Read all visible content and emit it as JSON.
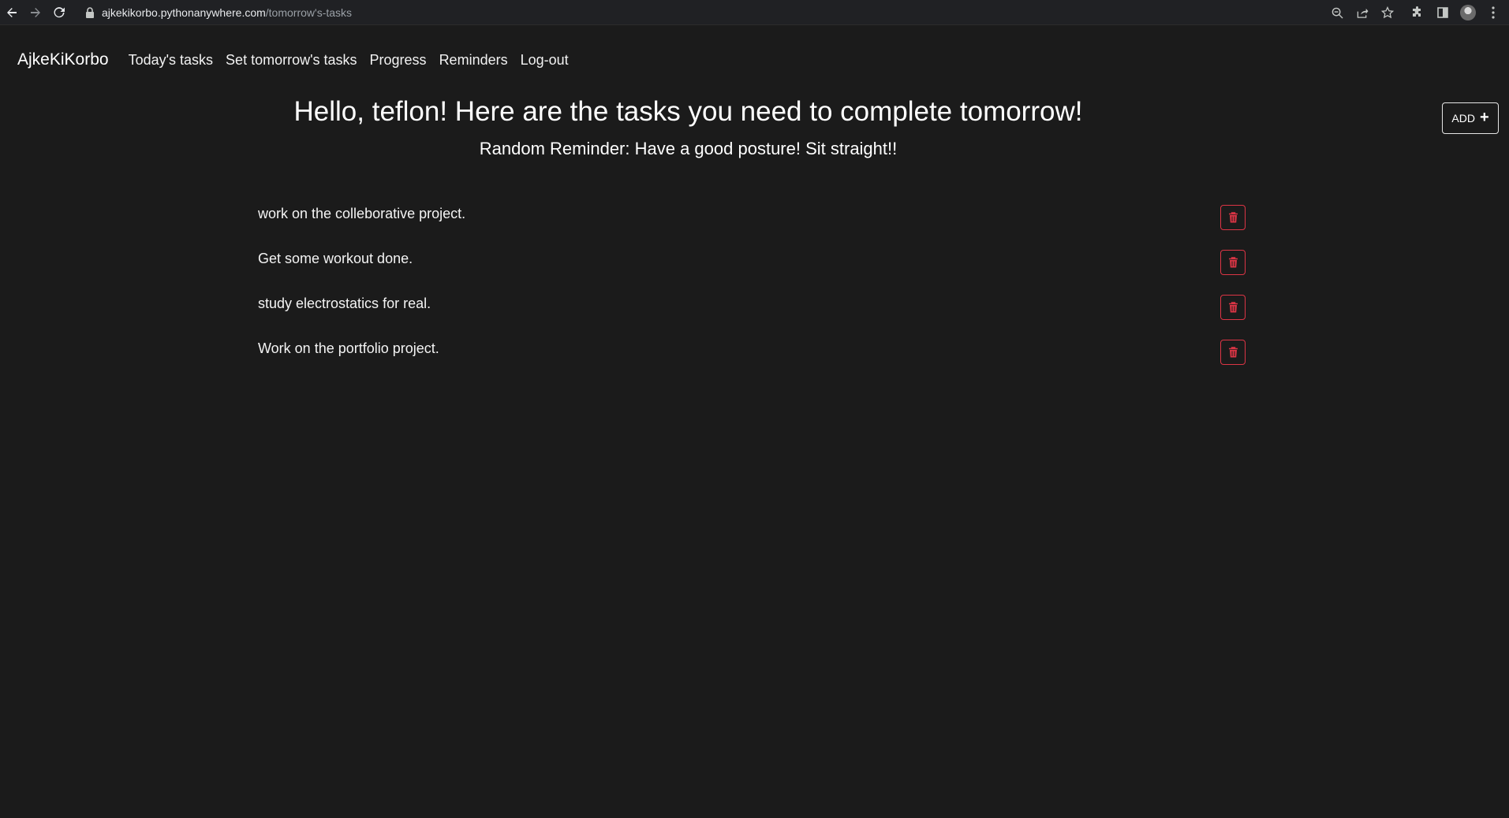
{
  "browser": {
    "url_host": "ajkekikorbo.pythonanywhere.com",
    "url_path": "/tomorrow's-tasks"
  },
  "nav": {
    "brand": "AjkeKiKorbo",
    "links": [
      "Today's tasks",
      "Set tomorrow's tasks",
      "Progress",
      "Reminders",
      "Log-out"
    ]
  },
  "main": {
    "heading": "Hello, teflon! Here are the tasks you need to complete tomorrow!",
    "reminder": "Random Reminder: Have a good posture! Sit straight!!",
    "add_label": "ADD",
    "tasks": [
      "work on the colleborative project.",
      "Get some workout done.",
      "study electrostatics for real.",
      "Work on the portfolio project."
    ]
  },
  "colors": {
    "background": "#1b1b1b",
    "danger": "#dc3545",
    "text": "#ffffff"
  }
}
